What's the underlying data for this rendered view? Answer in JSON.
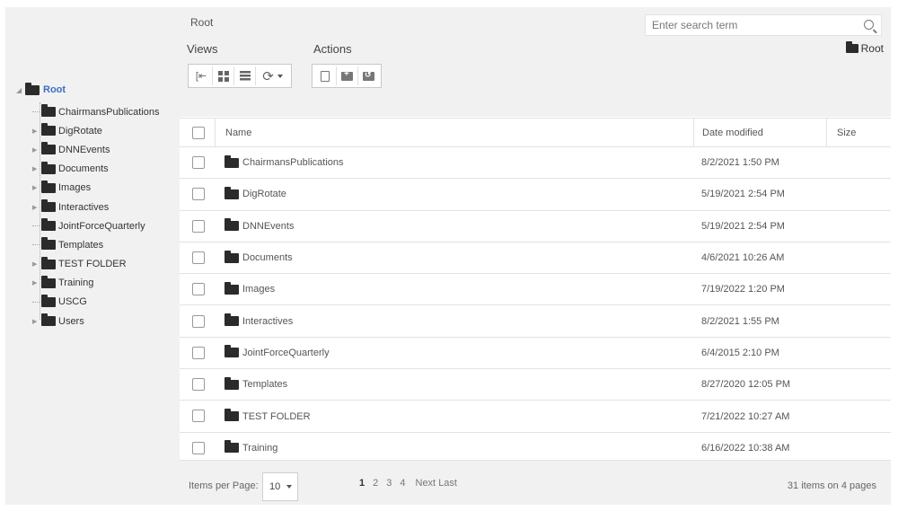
{
  "tree": {
    "root_label": "Root",
    "items": [
      {
        "label": "ChairmansPublications",
        "expandable": false
      },
      {
        "label": "DigRotate",
        "expandable": true
      },
      {
        "label": "DNNEvents",
        "expandable": true
      },
      {
        "label": "Documents",
        "expandable": true
      },
      {
        "label": "Images",
        "expandable": true
      },
      {
        "label": "Interactives",
        "expandable": true
      },
      {
        "label": "JointForceQuarterly",
        "expandable": false
      },
      {
        "label": "Templates",
        "expandable": false
      },
      {
        "label": "TEST FOLDER",
        "expandable": true
      },
      {
        "label": "Training",
        "expandable": true
      },
      {
        "label": "USCG",
        "expandable": false
      },
      {
        "label": "Users",
        "expandable": true
      }
    ]
  },
  "header": {
    "breadcrumb": "Root",
    "search_placeholder": "Enter search term",
    "views_label": "Views",
    "actions_label": "Actions",
    "current_folder": "Root"
  },
  "table": {
    "columns": {
      "name": "Name",
      "date": "Date modified",
      "size": "Size"
    },
    "rows": [
      {
        "name": "ChairmansPublications",
        "date": "8/2/2021 1:50 PM"
      },
      {
        "name": "DigRotate",
        "date": "5/19/2021 2:54 PM"
      },
      {
        "name": "DNNEvents",
        "date": "5/19/2021 2:54 PM"
      },
      {
        "name": "Documents",
        "date": "4/6/2021 10:26 AM"
      },
      {
        "name": "Images",
        "date": "7/19/2022 1:20 PM"
      },
      {
        "name": "Interactives",
        "date": "8/2/2021 1:55 PM"
      },
      {
        "name": "JointForceQuarterly",
        "date": "6/4/2015 2:10 PM"
      },
      {
        "name": "Templates",
        "date": "8/27/2020 12:05 PM"
      },
      {
        "name": "TEST FOLDER",
        "date": "7/21/2022 10:27 AM"
      },
      {
        "name": "Training",
        "date": "6/16/2022 10:38 AM"
      }
    ]
  },
  "footer": {
    "items_per_page_label": "Items per Page:",
    "items_per_page_value": "10",
    "pages": [
      "1",
      "2",
      "3",
      "4"
    ],
    "next_label": "Next",
    "last_label": "Last",
    "count_text": "31 items on 4 pages"
  }
}
